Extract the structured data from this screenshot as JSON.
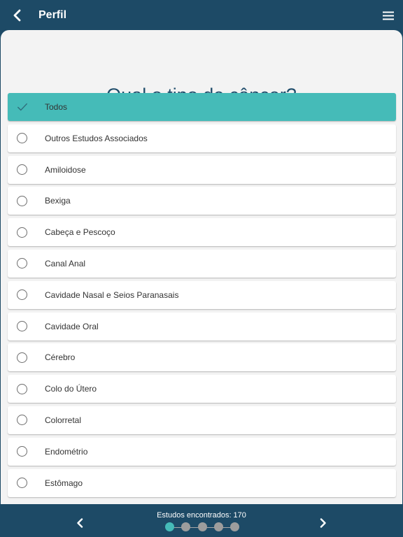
{
  "header": {
    "title": "Perfil",
    "back_icon": "chevron-left-icon",
    "menu_icon": "hamburger-menu-icon"
  },
  "question": {
    "text": "Qual o tipo de câncer?"
  },
  "options": [
    {
      "label": "Todos",
      "selected": true
    },
    {
      "label": "Outros Estudos Associados",
      "selected": false
    },
    {
      "label": "Amiloidose",
      "selected": false
    },
    {
      "label": "Bexiga",
      "selected": false
    },
    {
      "label": "Cabeça e Pescoço",
      "selected": false
    },
    {
      "label": "Canal Anal",
      "selected": false
    },
    {
      "label": "Cavidade Nasal e Seios Paranasais",
      "selected": false
    },
    {
      "label": "Cavidade Oral",
      "selected": false
    },
    {
      "label": "Cérebro",
      "selected": false
    },
    {
      "label": "Colo do Útero",
      "selected": false
    },
    {
      "label": "Colorretal",
      "selected": false
    },
    {
      "label": "Endométrio",
      "selected": false
    },
    {
      "label": "Estômago",
      "selected": false
    }
  ],
  "footer": {
    "studies_found": "Estudos encontrados: 170",
    "prev_icon": "chevron-left-icon",
    "next_icon": "chevron-right-icon",
    "steps_total": 5,
    "current_step": 1
  },
  "colors": {
    "primary": "#1d4a66",
    "accent": "#45bbb8",
    "background": "#f3f3f3"
  }
}
